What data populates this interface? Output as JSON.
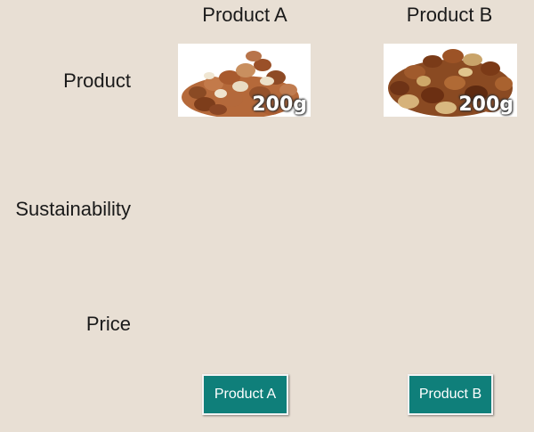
{
  "columns": {
    "a": {
      "header": "Product A",
      "weight_label": "200g",
      "button_label": "Product A"
    },
    "b": {
      "header": "Product B",
      "weight_label": "200g",
      "button_label": "Product B"
    }
  },
  "rows": {
    "product": "Product",
    "sustainability": "Sustainability",
    "price": "Price"
  },
  "colors": {
    "background": "#e8dfd4",
    "button": "#0f7f7a",
    "button_text": "#ffffff"
  }
}
